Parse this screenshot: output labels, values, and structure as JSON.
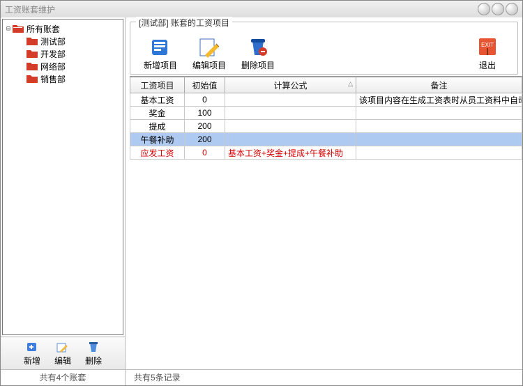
{
  "window": {
    "title": "工资账套维护"
  },
  "sidebar": {
    "root": "所有账套",
    "nodes": [
      "测试部",
      "开发部",
      "网络部",
      "销售部"
    ],
    "buttons": {
      "add": "新增",
      "edit": "编辑",
      "delete": "删除"
    },
    "status": "共有4个账套"
  },
  "main": {
    "group_title": "[测试部] 账套的工资项目",
    "buttons": {
      "add": "新增项目",
      "edit": "编辑项目",
      "delete": "删除项目",
      "exit": "退出"
    },
    "columns": {
      "name": "工资项目",
      "init": "初始值",
      "formula": "计算公式",
      "remark": "备注"
    },
    "rows": [
      {
        "name": "基本工资",
        "init": "0",
        "formula": "",
        "remark": "该项目内容在生成工资表时从员工资料中自动导入"
      },
      {
        "name": "奖金",
        "init": "100",
        "formula": "",
        "remark": ""
      },
      {
        "name": "提成",
        "init": "200",
        "formula": "",
        "remark": ""
      },
      {
        "name": "午餐补助",
        "init": "200",
        "formula": "",
        "remark": ""
      },
      {
        "name": "应发工资",
        "init": "0",
        "formula": "基本工资+奖金+提成+午餐补助",
        "remark": ""
      }
    ],
    "selected_index": 3,
    "formula_index": 4,
    "status": "共有5条记录"
  }
}
